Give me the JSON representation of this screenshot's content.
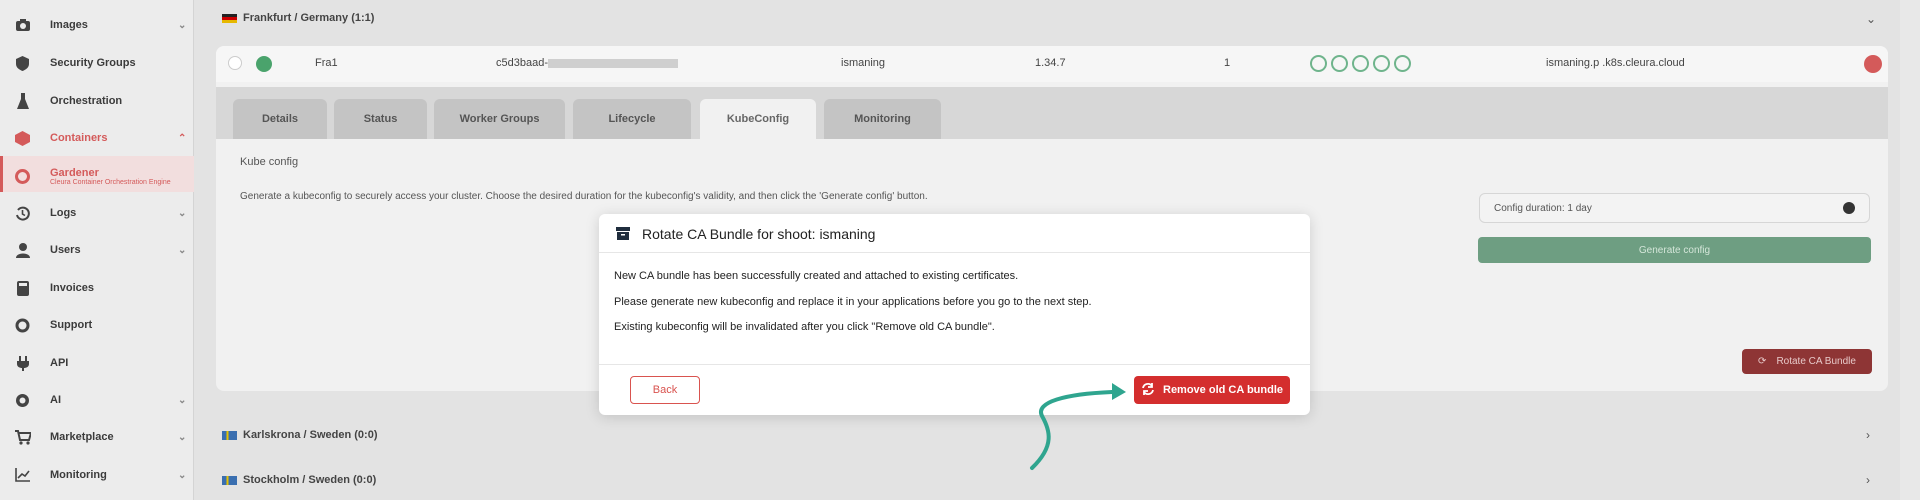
{
  "sidebar": {
    "items": [
      {
        "label": "Images",
        "icon": "camera-icon"
      },
      {
        "label": "Security Groups",
        "icon": "shield-icon"
      },
      {
        "label": "Orchestration",
        "icon": "flask-icon"
      },
      {
        "label": "Containers",
        "icon": "box-icon"
      },
      {
        "label": "Gardener",
        "sub": "Cleura Container Orchestration Engine",
        "icon": "target-icon"
      },
      {
        "label": "Logs",
        "icon": "history-icon"
      },
      {
        "label": "Users",
        "icon": "user-icon"
      },
      {
        "label": "Invoices",
        "icon": "calculator-icon"
      },
      {
        "label": "Support",
        "icon": "lifebuoy-icon"
      },
      {
        "label": "API",
        "icon": "plug-icon"
      },
      {
        "label": "AI",
        "icon": "chip-icon"
      },
      {
        "label": "Marketplace",
        "icon": "cart-icon"
      },
      {
        "label": "Monitoring",
        "icon": "chart-icon"
      }
    ]
  },
  "region_frankfurt": "Frankfurt / Germany (1:1)",
  "region_karlskrona": "Karlskrona / Sweden (0:0)",
  "region_stockholm": "Stockholm / Sweden (0:0)",
  "shoot": {
    "name": "Fra1",
    "uid": "c5d3baad-",
    "project": "ismaning",
    "version": "1.34.7",
    "count": "1",
    "endpoint": "ismaning.p .k8s.cleura.cloud"
  },
  "tabs": [
    "Details",
    "Status",
    "Worker Groups",
    "Lifecycle",
    "KubeConfig",
    "Monitoring"
  ],
  "kubeconfig": {
    "heading": "Kube config",
    "desc": "Generate a kubeconfig to securely access your cluster. Choose the desired duration for the kubeconfig's validity, and then click the 'Generate config' button.",
    "duration": "Config duration: 1 day",
    "generate": "Generate config",
    "rotate": "Rotate CA Bundle"
  },
  "modal": {
    "title": "Rotate CA Bundle for shoot: ismaning",
    "line1": "New CA bundle has been successfully created and attached to existing certificates.",
    "line2": "Please generate new kubeconfig and replace it in your applications before you go to the next step.",
    "line3": "Existing kubeconfig will be invalidated after you click \"Remove old CA bundle\".",
    "back": "Back",
    "remove": "Remove old CA bundle"
  },
  "colors": {
    "accent_red": "#d42e2e",
    "annotation_teal": "#2fa58f"
  }
}
